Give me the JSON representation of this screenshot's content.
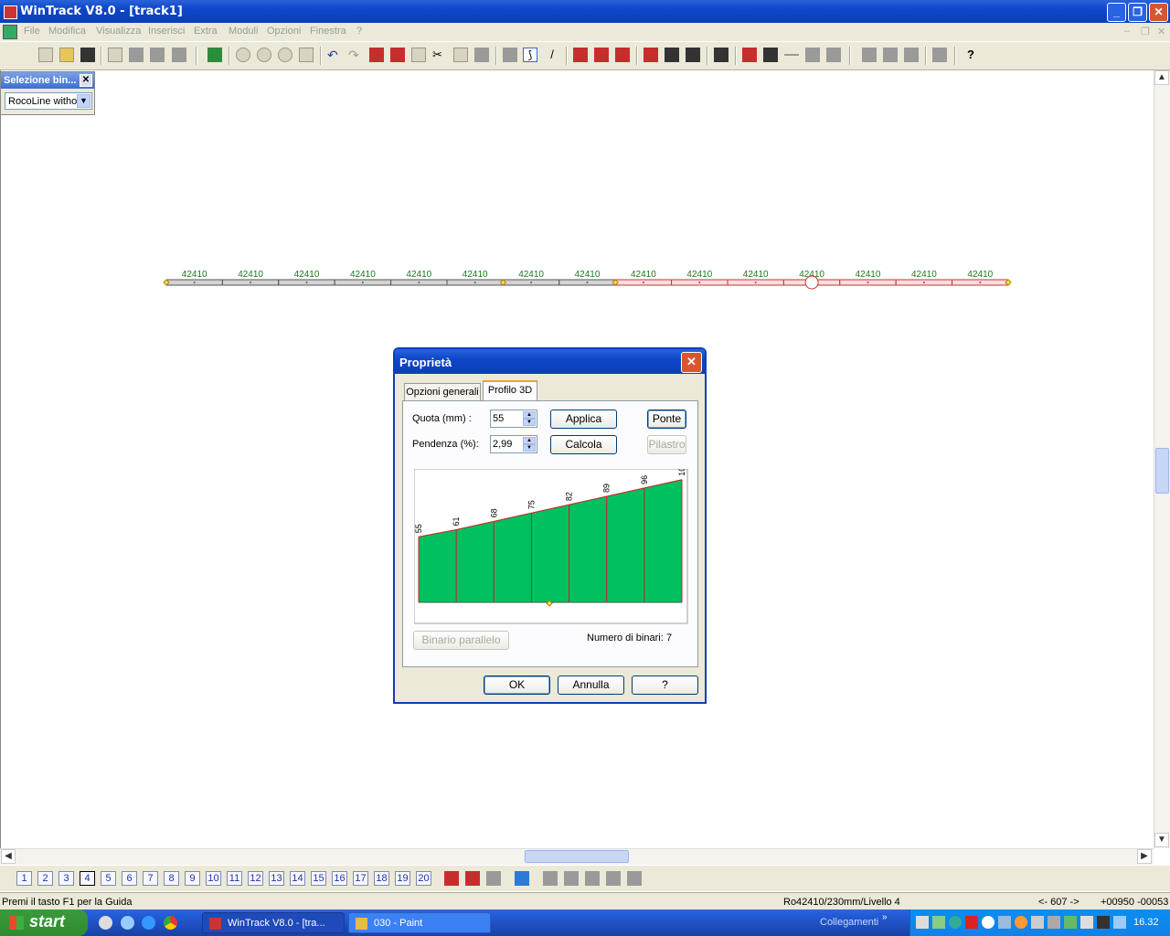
{
  "window": {
    "title": "WinTrack  V8.0 - [track1]"
  },
  "menu": [
    "File",
    "Modifica",
    "Visualizza",
    "Inserisci",
    "Extra",
    "Moduli",
    "Opzioni",
    "Finestra",
    "?"
  ],
  "selection_panel": {
    "title": "Selezione bin...",
    "selected": "RocoLine witho"
  },
  "track": {
    "labels": [
      "42410",
      "42410",
      "42410",
      "42410",
      "42410",
      "42410",
      "42410",
      "42410",
      "42410",
      "42410",
      "42410",
      "42410",
      "42410",
      "42410",
      "42410"
    ],
    "colors": {
      "inactive": "#555555",
      "active": "#d03030",
      "label": "#1a7a1a"
    }
  },
  "dialog": {
    "title": "Proprietà",
    "tabs": [
      "Opzioni generali",
      "Profilo 3D"
    ],
    "quota_label": "Quota (mm) :",
    "quota_value": "55",
    "pendenza_label": "Pendenza (%):",
    "pendenza_value": "2,99",
    "applica": "Applica",
    "calcola": "Calcola",
    "ponte": "Ponte",
    "pilastro": "Pilastro",
    "binario_parallelo": "Binario parallelo",
    "numero_label": "Numero di binari:",
    "numero_value": "7",
    "ok": "OK",
    "annulla": "Annulla",
    "help": "?"
  },
  "profile": {
    "heights": [
      55,
      61,
      68,
      75,
      82,
      89,
      96,
      103
    ],
    "labels": [
      "55",
      "61",
      "68",
      "75",
      "82",
      "89",
      "96",
      "103"
    ],
    "colors": {
      "fill": "#00c060",
      "line": "#cc2020"
    }
  },
  "levels": [
    "1",
    "2",
    "3",
    "4",
    "5",
    "6",
    "7",
    "8",
    "9",
    "10",
    "11",
    "12",
    "13",
    "14",
    "15",
    "16",
    "17",
    "18",
    "19",
    "20"
  ],
  "status": {
    "help": "Premi il tasto F1 per la Guida",
    "info": "Ro42410/230mm/Livello 4",
    "coord1": "<- 607 ->",
    "coord2": "+00950 -00053"
  },
  "taskbar": {
    "start": "start",
    "tasks": [
      "WinTrack  V8.0 - [tra...",
      "030 - Paint"
    ],
    "links": "Collegamenti",
    "clock": "16.32"
  }
}
